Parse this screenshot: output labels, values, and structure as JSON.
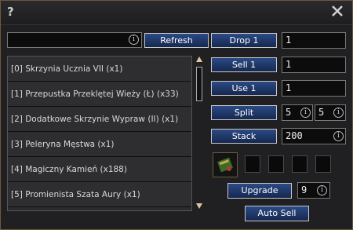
{
  "title": {
    "help": "?"
  },
  "search": {
    "value": ""
  },
  "refresh_label": "Refresh",
  "items": [
    "[0] Skrzynia Ucznia VII (x1)",
    "[1] Przepustka Przeklętej Wieży (Ł) (x33)",
    "[2] Dodatkowe Skrzynie Wypraw (II) (x1)",
    "[3] Peleryna Męstwa (x1)",
    "[4] Magiczny Kamień (x188)",
    "[5] Promienista Szata Aury (x1)"
  ],
  "actions": {
    "drop": {
      "label": "Drop 1",
      "value": "1"
    },
    "sell": {
      "label": "Sell 1",
      "value": "1"
    },
    "use": {
      "label": "Use 1",
      "value": "1"
    },
    "split": {
      "label": "Split",
      "value1": "5",
      "value2": "5"
    },
    "stack": {
      "label": "Stack",
      "value": "200"
    },
    "upgrade": {
      "label": "Upgrade",
      "value": "9"
    },
    "autosell": {
      "label": "Auto Sell"
    }
  },
  "info_glyph": "i",
  "colors": {
    "button_bg": "#1f3a6e",
    "border_gold": "#6b5a3a"
  }
}
